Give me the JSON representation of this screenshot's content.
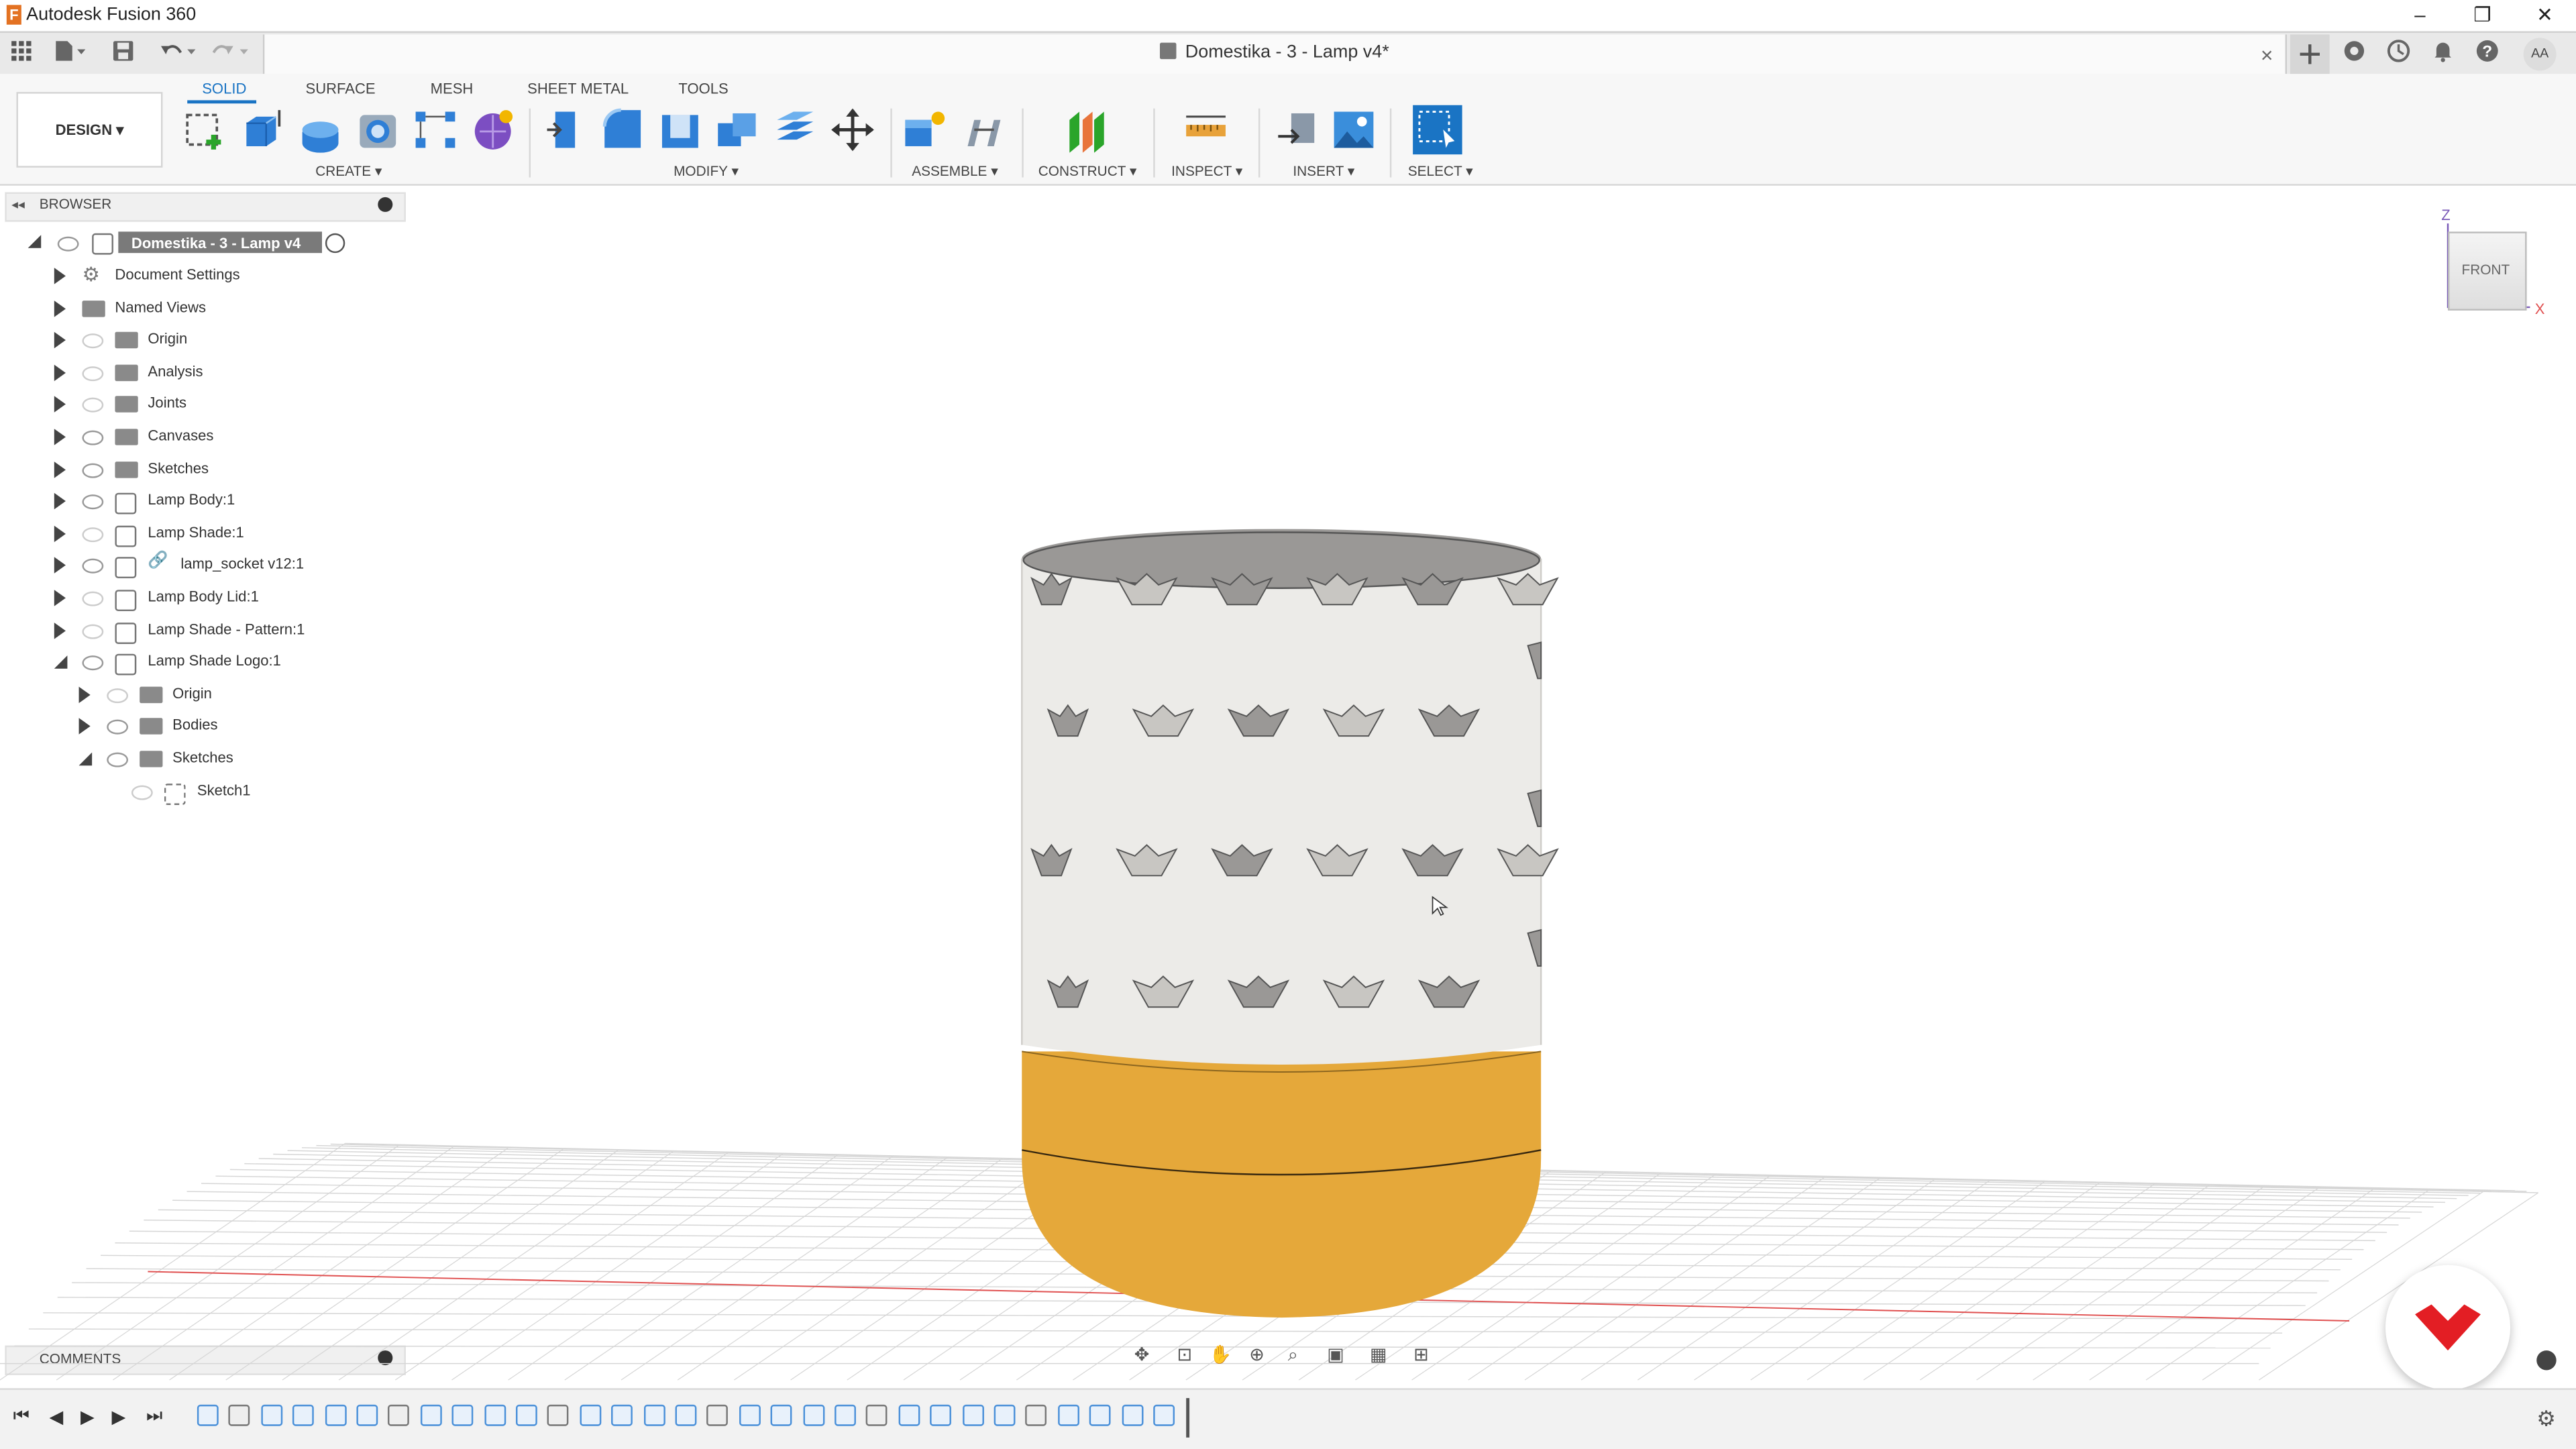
{
  "window": {
    "app_title": "Autodesk Fusion 360",
    "app_logo_letter": "F",
    "minimize": "–",
    "restore": "❐",
    "close": "✕"
  },
  "quick_access": {
    "document_tab_title": "Domestika - 3 - Lamp v4*",
    "tab_close": "×",
    "avatar_initials": "AA"
  },
  "toolbar": {
    "workspace_label": "DESIGN ▾",
    "tabs": [
      "SOLID",
      "SURFACE",
      "MESH",
      "SHEET METAL",
      "TOOLS"
    ],
    "groups": {
      "create": "CREATE ▾",
      "modify": "MODIFY ▾",
      "assemble": "ASSEMBLE ▾",
      "construct": "CONSTRUCT ▾",
      "inspect": "INSPECT ▾",
      "insert": "INSERT ▾",
      "select": "SELECT ▾"
    }
  },
  "browser": {
    "title": "BROWSER",
    "root_label": "Domestika - 3 - Lamp v4",
    "items": [
      {
        "label": "Document Settings"
      },
      {
        "label": "Named Views"
      },
      {
        "label": "Origin"
      },
      {
        "label": "Analysis"
      },
      {
        "label": "Joints"
      },
      {
        "label": "Canvases"
      },
      {
        "label": "Sketches"
      },
      {
        "label": "Lamp Body:1"
      },
      {
        "label": "Lamp Shade:1"
      },
      {
        "label": "lamp_socket v12:1"
      },
      {
        "label": "Lamp Body Lid:1"
      },
      {
        "label": "Lamp Shade - Pattern:1"
      },
      {
        "label": "Lamp Shade Logo:1"
      },
      {
        "label": "Origin"
      },
      {
        "label": "Bodies"
      },
      {
        "label": "Sketches"
      },
      {
        "label": "Sketch1"
      }
    ]
  },
  "comments": {
    "title": "COMMENTS"
  },
  "viewcube": {
    "face_label": "FRONT",
    "axis_z": "Z",
    "axis_x": "X"
  },
  "colors": {
    "accent": "#1a74c4",
    "lamp_shade": "#ecebe8",
    "lamp_base": "#e5a83a",
    "brand_red": "#e31e24",
    "grid_line": "#d6d6d6",
    "x_axis": "#e05050"
  }
}
